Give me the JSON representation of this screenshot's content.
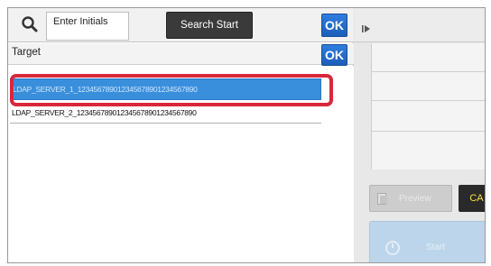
{
  "search": {
    "field_value": "Enter Initials",
    "button_label": "Search Start",
    "ok_label": "OK"
  },
  "target": {
    "label": "Target",
    "ok_label": "OK"
  },
  "list": {
    "items": [
      {
        "label": "LDAP_SERVER_1_12345678901234567890123456789​0",
        "selected": true
      },
      {
        "label": "LDAP_SERVER_2_12345678901234567890123456789​0",
        "selected": false
      }
    ]
  },
  "right_panel": {
    "preview_label": "Preview",
    "ca_label": "CA",
    "start_label": "Start"
  },
  "colors": {
    "ok_blue": "#1f6bd0",
    "selection_blue": "#3a8fdc",
    "highlight_red": "#d9273a",
    "ca_text": "#ffe14d"
  },
  "icons": [
    "search-icon",
    "play-icon",
    "preview-icon",
    "start-icon"
  ]
}
